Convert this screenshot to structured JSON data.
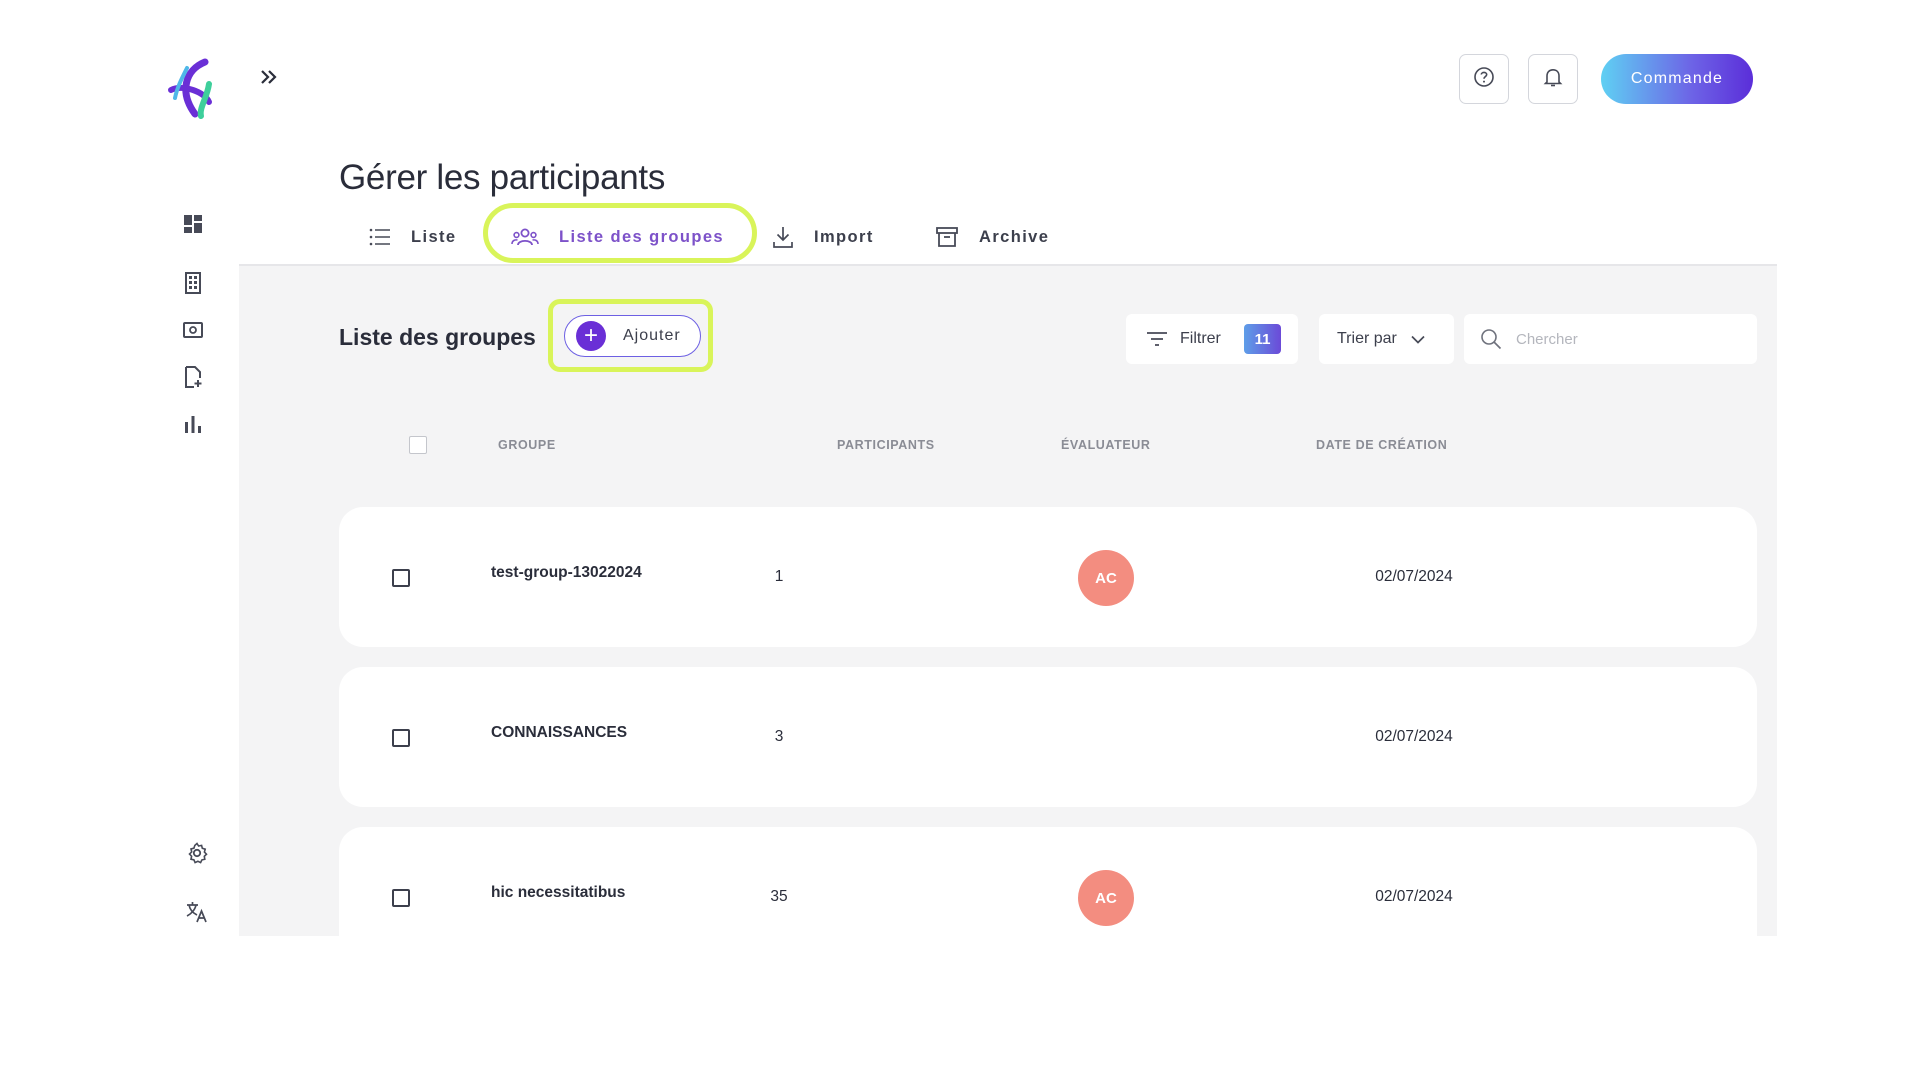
{
  "header": {
    "help_icon": "question-circle-icon",
    "bell_icon": "bell-icon",
    "command_label": "Commande"
  },
  "sidebar": {
    "items": [
      {
        "name": "dashboard",
        "icon": "dashboard-icon"
      },
      {
        "name": "buildings",
        "icon": "building-icon"
      },
      {
        "name": "screen",
        "icon": "screen-icon"
      },
      {
        "name": "add-document",
        "icon": "document-add-icon"
      },
      {
        "name": "statistics",
        "icon": "bar-chart-icon"
      }
    ],
    "bottom": [
      {
        "name": "settings",
        "icon": "gear-icon"
      },
      {
        "name": "language",
        "icon": "translate-icon"
      }
    ]
  },
  "page": {
    "title": "Gérer les participants"
  },
  "tabs": [
    {
      "label": "Liste",
      "icon": "list-icon",
      "active": false
    },
    {
      "label": "Liste des groupes",
      "icon": "group-icon",
      "active": true
    },
    {
      "label": "Import",
      "icon": "download-icon",
      "active": false
    },
    {
      "label": "Archive",
      "icon": "archive-icon",
      "active": false
    }
  ],
  "toolbar": {
    "section_title": "Liste des groupes",
    "add_label": "Ajouter",
    "filter_label": "Filtrer",
    "filter_count": "11",
    "sort_label": "Trier par",
    "search_placeholder": "Chercher",
    "search_value": ""
  },
  "table": {
    "columns": [
      "GROUPE",
      "PARTICIPANTS",
      "ÉVALUATEUR",
      "DATE DE CRÉATION"
    ],
    "rows": [
      {
        "group": "test-group-13022024",
        "participants": "1",
        "evaluator": "AC",
        "date": "02/07/2024"
      },
      {
        "group": "CONNAISSANCES",
        "participants": "3",
        "evaluator": "",
        "date": "02/07/2024"
      },
      {
        "group": "hic necessitatibus",
        "participants": "35",
        "evaluator": "AC",
        "date": "02/07/2024"
      }
    ]
  },
  "colors": {
    "accent": "#6a2fd6",
    "active_tab": "#7d52c9",
    "highlight": "#d9f45a",
    "avatar": "#f38d80",
    "content_bg": "#f4f4f5"
  }
}
